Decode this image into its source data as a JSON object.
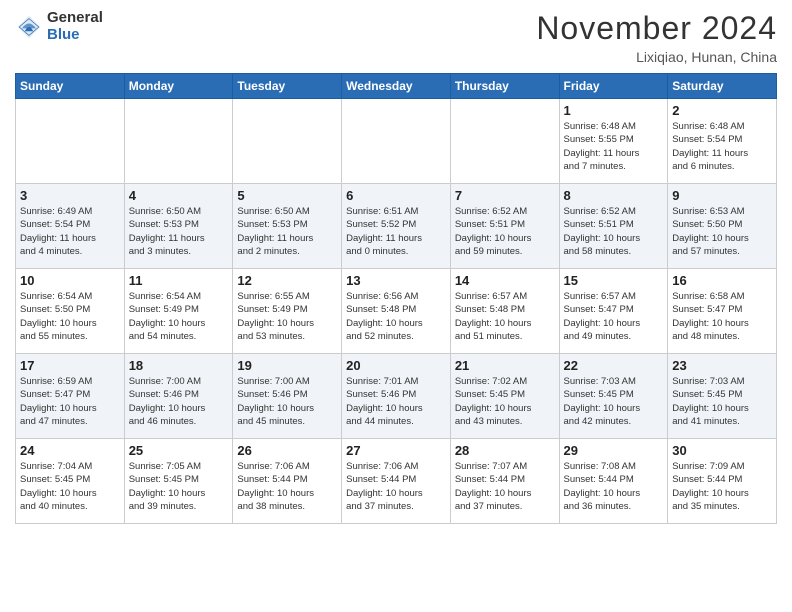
{
  "header": {
    "logo_general": "General",
    "logo_blue": "Blue",
    "month_title": "November 2024",
    "location": "Lixiqiao, Hunan, China"
  },
  "weekdays": [
    "Sunday",
    "Monday",
    "Tuesday",
    "Wednesday",
    "Thursday",
    "Friday",
    "Saturday"
  ],
  "weeks": [
    [
      {
        "day": "",
        "info": ""
      },
      {
        "day": "",
        "info": ""
      },
      {
        "day": "",
        "info": ""
      },
      {
        "day": "",
        "info": ""
      },
      {
        "day": "",
        "info": ""
      },
      {
        "day": "1",
        "info": "Sunrise: 6:48 AM\nSunset: 5:55 PM\nDaylight: 11 hours\nand 7 minutes."
      },
      {
        "day": "2",
        "info": "Sunrise: 6:48 AM\nSunset: 5:54 PM\nDaylight: 11 hours\nand 6 minutes."
      }
    ],
    [
      {
        "day": "3",
        "info": "Sunrise: 6:49 AM\nSunset: 5:54 PM\nDaylight: 11 hours\nand 4 minutes."
      },
      {
        "day": "4",
        "info": "Sunrise: 6:50 AM\nSunset: 5:53 PM\nDaylight: 11 hours\nand 3 minutes."
      },
      {
        "day": "5",
        "info": "Sunrise: 6:50 AM\nSunset: 5:53 PM\nDaylight: 11 hours\nand 2 minutes."
      },
      {
        "day": "6",
        "info": "Sunrise: 6:51 AM\nSunset: 5:52 PM\nDaylight: 11 hours\nand 0 minutes."
      },
      {
        "day": "7",
        "info": "Sunrise: 6:52 AM\nSunset: 5:51 PM\nDaylight: 10 hours\nand 59 minutes."
      },
      {
        "day": "8",
        "info": "Sunrise: 6:52 AM\nSunset: 5:51 PM\nDaylight: 10 hours\nand 58 minutes."
      },
      {
        "day": "9",
        "info": "Sunrise: 6:53 AM\nSunset: 5:50 PM\nDaylight: 10 hours\nand 57 minutes."
      }
    ],
    [
      {
        "day": "10",
        "info": "Sunrise: 6:54 AM\nSunset: 5:50 PM\nDaylight: 10 hours\nand 55 minutes."
      },
      {
        "day": "11",
        "info": "Sunrise: 6:54 AM\nSunset: 5:49 PM\nDaylight: 10 hours\nand 54 minutes."
      },
      {
        "day": "12",
        "info": "Sunrise: 6:55 AM\nSunset: 5:49 PM\nDaylight: 10 hours\nand 53 minutes."
      },
      {
        "day": "13",
        "info": "Sunrise: 6:56 AM\nSunset: 5:48 PM\nDaylight: 10 hours\nand 52 minutes."
      },
      {
        "day": "14",
        "info": "Sunrise: 6:57 AM\nSunset: 5:48 PM\nDaylight: 10 hours\nand 51 minutes."
      },
      {
        "day": "15",
        "info": "Sunrise: 6:57 AM\nSunset: 5:47 PM\nDaylight: 10 hours\nand 49 minutes."
      },
      {
        "day": "16",
        "info": "Sunrise: 6:58 AM\nSunset: 5:47 PM\nDaylight: 10 hours\nand 48 minutes."
      }
    ],
    [
      {
        "day": "17",
        "info": "Sunrise: 6:59 AM\nSunset: 5:47 PM\nDaylight: 10 hours\nand 47 minutes."
      },
      {
        "day": "18",
        "info": "Sunrise: 7:00 AM\nSunset: 5:46 PM\nDaylight: 10 hours\nand 46 minutes."
      },
      {
        "day": "19",
        "info": "Sunrise: 7:00 AM\nSunset: 5:46 PM\nDaylight: 10 hours\nand 45 minutes."
      },
      {
        "day": "20",
        "info": "Sunrise: 7:01 AM\nSunset: 5:46 PM\nDaylight: 10 hours\nand 44 minutes."
      },
      {
        "day": "21",
        "info": "Sunrise: 7:02 AM\nSunset: 5:45 PM\nDaylight: 10 hours\nand 43 minutes."
      },
      {
        "day": "22",
        "info": "Sunrise: 7:03 AM\nSunset: 5:45 PM\nDaylight: 10 hours\nand 42 minutes."
      },
      {
        "day": "23",
        "info": "Sunrise: 7:03 AM\nSunset: 5:45 PM\nDaylight: 10 hours\nand 41 minutes."
      }
    ],
    [
      {
        "day": "24",
        "info": "Sunrise: 7:04 AM\nSunset: 5:45 PM\nDaylight: 10 hours\nand 40 minutes."
      },
      {
        "day": "25",
        "info": "Sunrise: 7:05 AM\nSunset: 5:45 PM\nDaylight: 10 hours\nand 39 minutes."
      },
      {
        "day": "26",
        "info": "Sunrise: 7:06 AM\nSunset: 5:44 PM\nDaylight: 10 hours\nand 38 minutes."
      },
      {
        "day": "27",
        "info": "Sunrise: 7:06 AM\nSunset: 5:44 PM\nDaylight: 10 hours\nand 37 minutes."
      },
      {
        "day": "28",
        "info": "Sunrise: 7:07 AM\nSunset: 5:44 PM\nDaylight: 10 hours\nand 37 minutes."
      },
      {
        "day": "29",
        "info": "Sunrise: 7:08 AM\nSunset: 5:44 PM\nDaylight: 10 hours\nand 36 minutes."
      },
      {
        "day": "30",
        "info": "Sunrise: 7:09 AM\nSunset: 5:44 PM\nDaylight: 10 hours\nand 35 minutes."
      }
    ]
  ]
}
